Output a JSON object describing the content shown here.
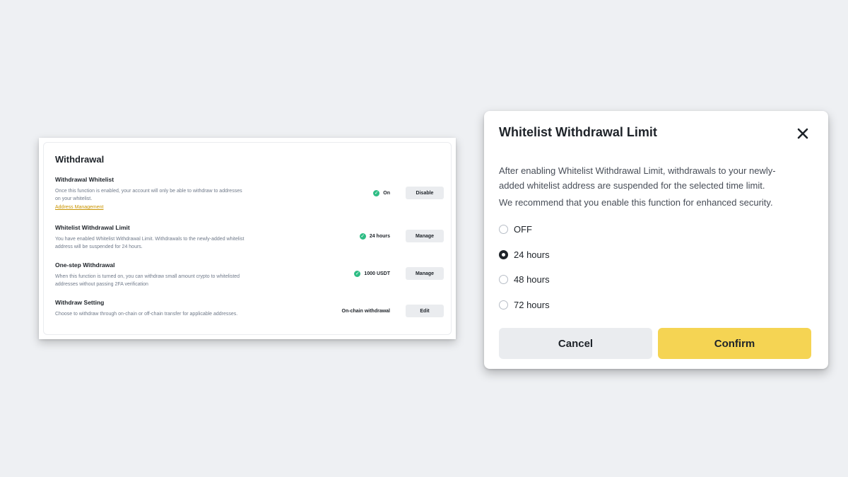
{
  "withdrawal_panel": {
    "title": "Withdrawal",
    "rows": [
      {
        "title": "Withdrawal Whitelist",
        "description": "Once this function is enabled, your account will only be able to withdraw to addresses on your whitelist.",
        "link": "Address Management",
        "status": "On",
        "button": "Disable"
      },
      {
        "title": "Whitelist Withdrawal Limit",
        "description": "You have enabled Whitelist Withdrawal Limit. Withdrawals to the newly-added whitelist address will be suspended for 24 hours.",
        "status": "24 hours",
        "button": "Manage"
      },
      {
        "title": "One-step Withdrawal",
        "description": "When this function is turned on, you can withdraw small amount crypto to whitelisted addresses without passing 2FA verification",
        "status": "1000 USDT",
        "button": "Manage"
      },
      {
        "title": "Withdraw Setting",
        "description": "Choose to withdraw through on-chain or off-chain transfer for applicable addresses.",
        "status": "On-chain withdrawal",
        "button": "Edit"
      }
    ]
  },
  "modal": {
    "title": "Whitelist Withdrawal Limit",
    "close_icon": "close-icon",
    "description": "After enabling Whitelist Withdrawal Limit, withdrawals to your newly-added whitelist address are suspended for the selected time limit.",
    "recommendation": "We recommend that you enable this function for enhanced security.",
    "options": [
      {
        "label": "OFF",
        "checked": false
      },
      {
        "label": "24 hours",
        "checked": true
      },
      {
        "label": "48 hours",
        "checked": false
      },
      {
        "label": "72 hours",
        "checked": false
      }
    ],
    "cancel_label": "Cancel",
    "confirm_label": "Confirm"
  },
  "colors": {
    "background": "#eef0f3",
    "accent_yellow": "#f5d453",
    "success_green": "#2ebd85",
    "link_gold": "#c99400",
    "button_gray": "#eaecef"
  }
}
